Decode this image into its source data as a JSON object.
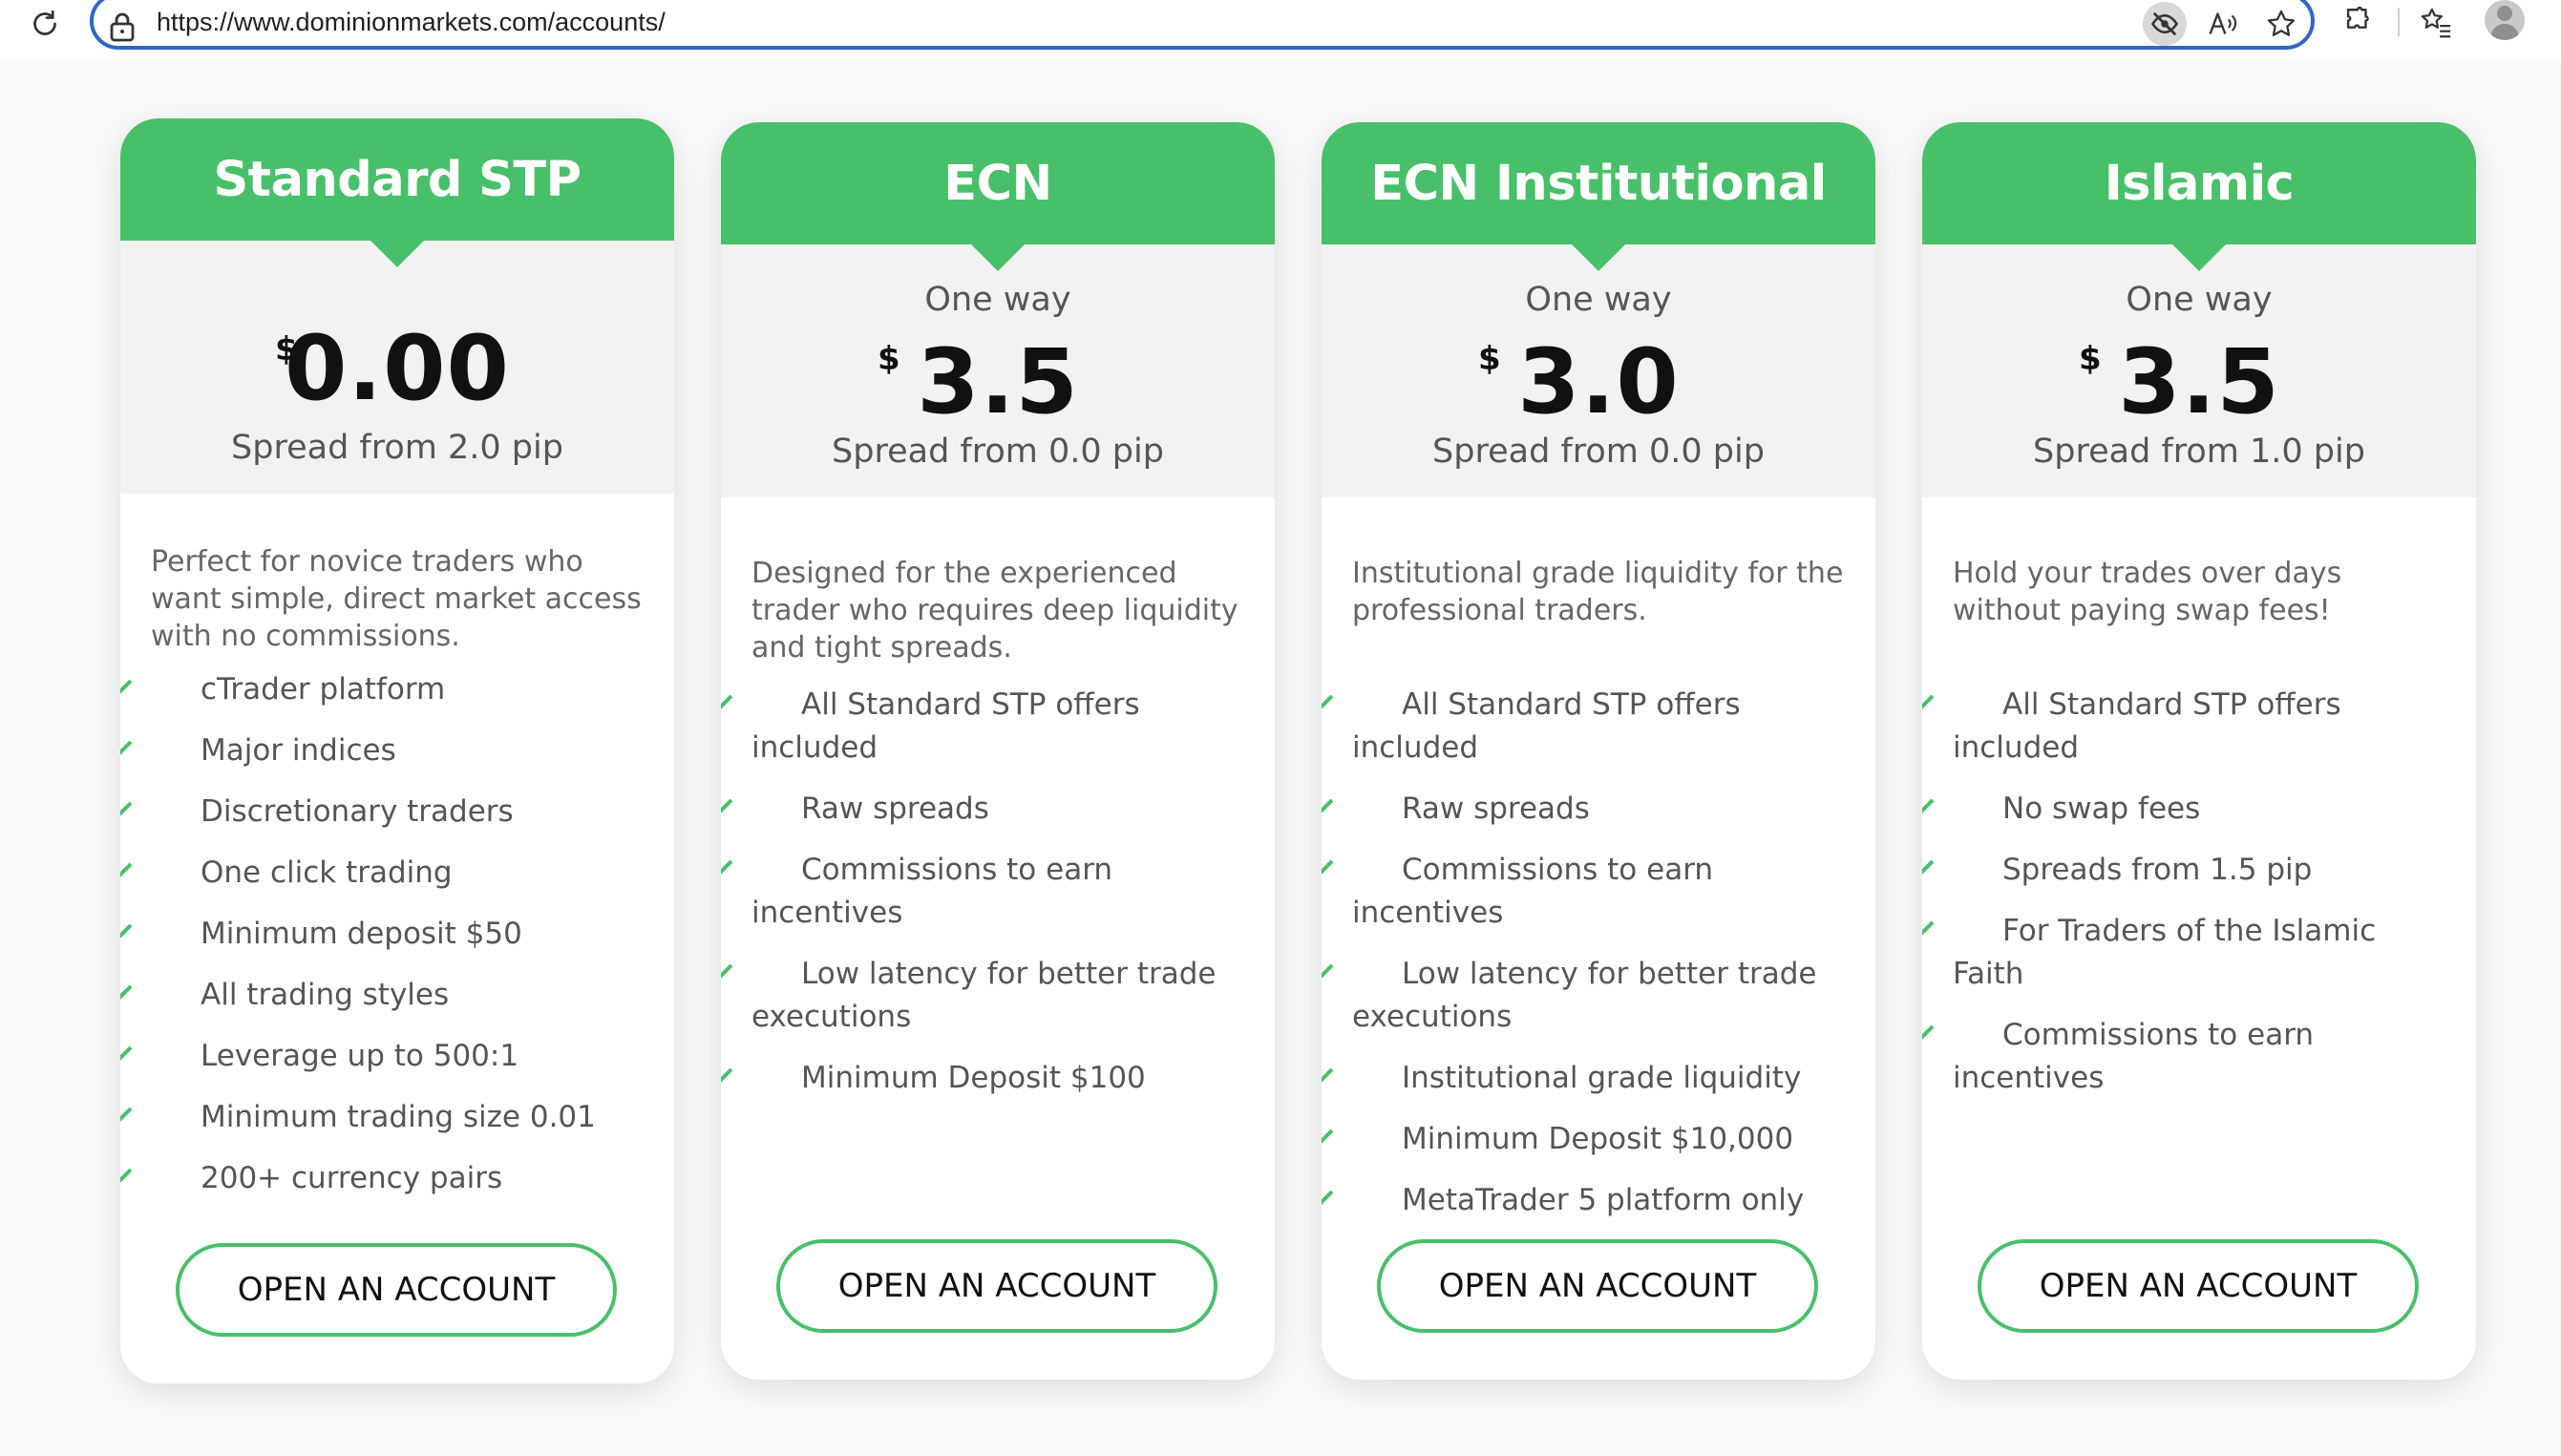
{
  "browser": {
    "url": "https://www.dominionmarkets.com/accounts/",
    "icons": [
      "reload-icon",
      "lock-icon",
      "tracking-prevention-icon",
      "read-aloud-icon",
      "favorite-star-icon",
      "extensions-icon",
      "favorites-icon",
      "profile-avatar"
    ]
  },
  "colors": {
    "accent": "#48c06a",
    "price_bg": "#f2f2f2",
    "text": "#555555"
  },
  "cards": [
    {
      "title": "Standard STP",
      "one_way": "",
      "currency": "$",
      "amount": "0.00",
      "spread": "Spread from 2.0 pip",
      "description": "Perfect for novice traders who want simple, direct market access with no commissions.",
      "features": [
        "cTrader platform",
        "Major indices",
        "Discretionary traders",
        "One click trading",
        "Minimum deposit $50",
        "All trading styles",
        "Leverage up to 500:1",
        "Minimum trading size 0.01",
        "200+ currency pairs"
      ],
      "button": "OPEN AN ACCOUNT"
    },
    {
      "title": "ECN",
      "one_way": "One way",
      "currency": "$",
      "amount": "3.5",
      "spread": "Spread from 0.0 pip",
      "description": "Designed for the experienced trader who requires deep liquidity and tight spreads.",
      "features": [
        "All Standard STP offers included",
        "Raw spreads",
        "Commissions to earn incentives",
        "Low latency for better trade executions",
        "Minimum Deposit $100"
      ],
      "button": "OPEN AN ACCOUNT"
    },
    {
      "title": "ECN Institutional",
      "one_way": "One way",
      "currency": "$",
      "amount": "3.0",
      "spread": "Spread from 0.0 pip",
      "description": "Institutional grade liquidity for the professional traders.",
      "features": [
        "All Standard STP offers included",
        "Raw spreads",
        "Commissions to earn incentives",
        "Low latency for better trade executions",
        "Institutional grade liquidity",
        "Minimum Deposit $10,000",
        "MetaTrader 5 platform only"
      ],
      "button": "OPEN AN ACCOUNT"
    },
    {
      "title": "Islamic",
      "one_way": "One way",
      "currency": "$",
      "amount": "3.5",
      "spread": "Spread from 1.0 pip",
      "description": "Hold your trades over days without paying swap fees!",
      "features": [
        "All Standard STP offers included",
        "No swap fees",
        "Spreads from 1.5 pip",
        "For Traders of the Islamic Faith",
        "Commissions to earn incentives"
      ],
      "button": "OPEN AN ACCOUNT"
    }
  ]
}
